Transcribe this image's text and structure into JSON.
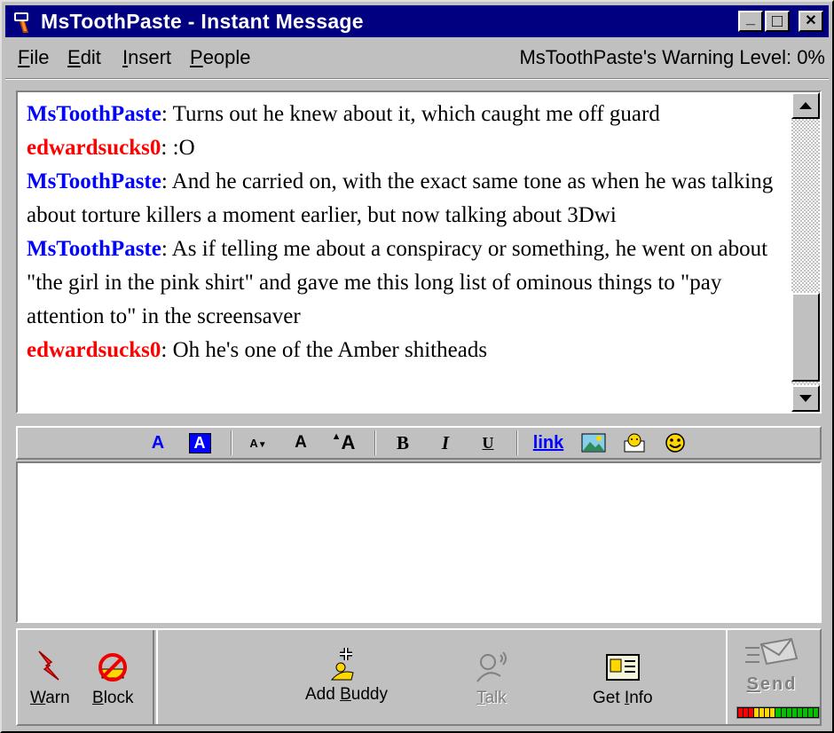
{
  "window": {
    "title": "MsToothPaste - Instant Message",
    "minimize_glyph": "_",
    "maximize_glyph": "□",
    "close_glyph": "✕"
  },
  "menu": {
    "items": [
      {
        "label": "File",
        "accel": "F",
        "rest": "ile"
      },
      {
        "label": "Edit",
        "accel": "E",
        "rest": "dit"
      },
      {
        "label": "Insert",
        "accel": "I",
        "rest": "nsert"
      },
      {
        "label": "People",
        "accel": "P",
        "rest": "eople"
      }
    ],
    "warning_level": "MsToothPaste's Warning Level: 0%"
  },
  "conversation": {
    "messages": [
      {
        "sender": "MsToothPaste",
        "color": "blue",
        "text": ": Turns out he knew about it, which caught me off guard"
      },
      {
        "sender": "edwardsucks0",
        "color": "red",
        "text": ": :O"
      },
      {
        "sender": "MsToothPaste",
        "color": "blue",
        "text": ": And he carried on, with the exact same tone as when he was talking about torture killers a moment earlier, but now talking about 3Dwi"
      },
      {
        "sender": "MsToothPaste",
        "color": "blue",
        "text": ": As if telling me about a conspiracy or something, he went on about \"the girl in the pink shirt\" and gave me this long list of ominous things to \"pay attention to\" in the screensaver"
      },
      {
        "sender": "edwardsucks0",
        "color": "red",
        "text": ": Oh he's one of the Amber shitheads"
      }
    ]
  },
  "format_toolbar": {
    "text_color_glyph": "A",
    "bg_color_glyph": "A",
    "smaller_font_glyph": "A",
    "normal_font_glyph": "A",
    "larger_font_glyph": "A",
    "bold_glyph": "B",
    "italic_glyph": "I",
    "underline_glyph": "U",
    "link_label": "link",
    "colors": {
      "blue": "#0000ff",
      "red": "#ff0000"
    }
  },
  "input": {
    "value": ""
  },
  "buttons": {
    "warn": {
      "accel": "W",
      "rest": "arn"
    },
    "block": {
      "accel": "B",
      "rest": "lock"
    },
    "add_buddy": {
      "pre": "Add ",
      "accel": "B",
      "rest": "uddy"
    },
    "talk": {
      "accel": "T",
      "rest": "alk"
    },
    "get_info": {
      "pre": "Get ",
      "accel": "I",
      "rest": "nfo"
    },
    "send": {
      "accel": "S",
      "rest": "end"
    }
  },
  "icons": [
    "app-icon",
    "minimize-icon",
    "maximize-icon",
    "close-icon",
    "scroll-up-icon",
    "scroll-down-icon",
    "text-color-icon",
    "background-color-icon",
    "smaller-font-icon",
    "normal-font-icon",
    "larger-font-icon",
    "bold-icon",
    "italic-icon",
    "underline-icon",
    "link-icon",
    "insert-image-icon",
    "background-image-icon",
    "smiley-icon",
    "warn-icon",
    "block-icon",
    "add-buddy-icon",
    "talk-icon",
    "get-info-icon",
    "send-icon"
  ],
  "signal_meter": {
    "level": 1.0
  }
}
